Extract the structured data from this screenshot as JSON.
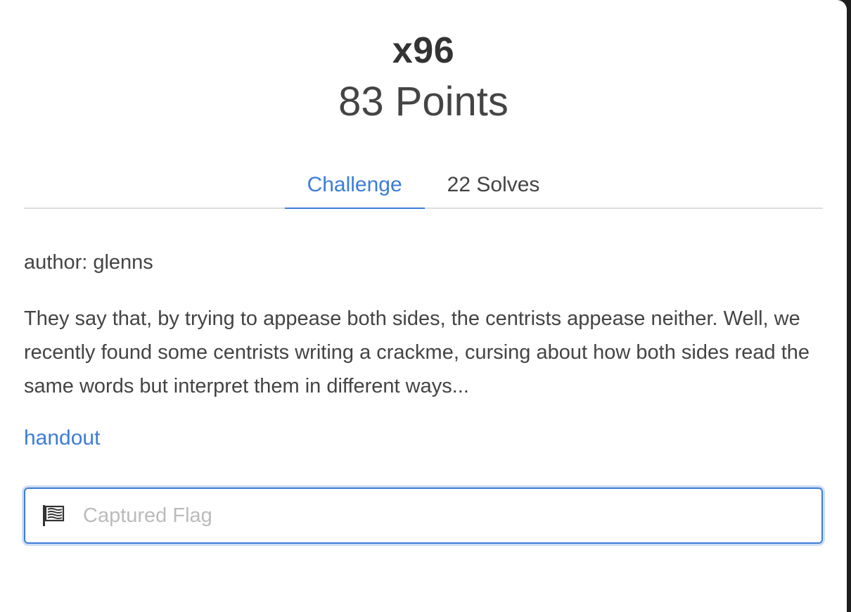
{
  "challenge": {
    "name": "x96",
    "points": "83 Points"
  },
  "tabs": [
    {
      "label": "Challenge"
    },
    {
      "label": "22 Solves"
    }
  ],
  "author": "author: glenns",
  "description": "They say that, by trying to appease both sides, the centrists appease neither. Well, we recently found some centrists writing a crackme, cursing about how both sides read the same words but interpret them in different ways...",
  "handout": {
    "label": "handout"
  },
  "flag_input": {
    "placeholder": "Captured Flag",
    "value": "",
    "icon": "flag-icon"
  },
  "colors": {
    "accent": "#3b7dd8",
    "text": "#444444",
    "title": "#333333",
    "placeholder": "#bbbbbb",
    "border": "#dddddd"
  }
}
